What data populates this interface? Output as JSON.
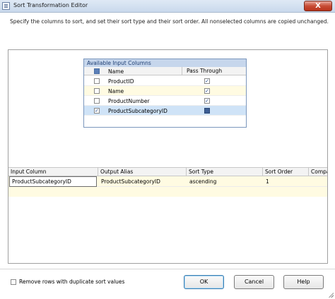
{
  "window": {
    "title": "Sort Transformation Editor",
    "close_glyph": "X"
  },
  "instruction": "Specify the columns to sort, and set their sort type and their sort order. All nonselected columns are copied unchanged.",
  "available_columns": {
    "title": "Available Input Columns",
    "header_name": "Name",
    "header_pass_through": "Pass Through",
    "rows": [
      {
        "name": "ProductID",
        "checked": false,
        "pass_through": true
      },
      {
        "name": "Name",
        "checked": false,
        "pass_through": true
      },
      {
        "name": "ProductNumber",
        "checked": false,
        "pass_through": true
      },
      {
        "name": "ProductSubcategoryID",
        "checked": true,
        "pass_through": true
      }
    ]
  },
  "grid": {
    "headers": [
      "Input Column",
      "Output Alias",
      "Sort Type",
      "Sort Order",
      "Compa"
    ],
    "rows": [
      {
        "input_column": "ProductSubcategoryID",
        "output_alias": "ProductSubcategoryID",
        "sort_type": "ascending",
        "sort_order": "1",
        "comparison": ""
      }
    ]
  },
  "remove_duplicates": {
    "label": "Remove rows with duplicate sort values",
    "checked": false
  },
  "buttons": {
    "ok": "OK",
    "cancel": "Cancel",
    "help": "Help"
  },
  "colors": {
    "title_bar": "#c9d9ec",
    "close_button": "#c74c35",
    "row_highlight": "#fffbe2",
    "selected_row": "#cfe3f7",
    "group_header": "#c6d6ec"
  },
  "icons": {
    "window_icon": "dialog-icon",
    "close_icon": "close-icon"
  }
}
